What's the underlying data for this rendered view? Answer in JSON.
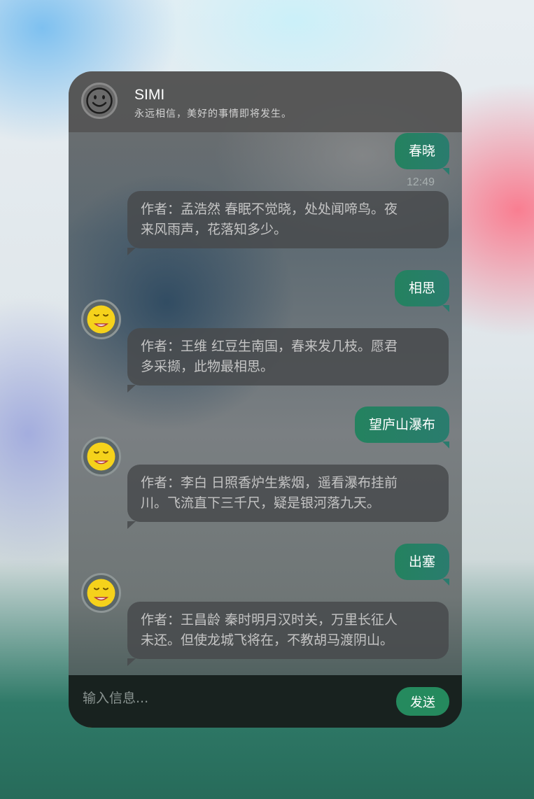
{
  "header": {
    "title": "SIMI",
    "subtitle": "永远相信，美好的事情即将发生。",
    "avatar_icon": "smiley-face-icon"
  },
  "messages": [
    {
      "from": "user",
      "text": "春晓"
    },
    {
      "from": "timestamp",
      "text": "12:49"
    },
    {
      "from": "bot",
      "lines": [
        "作者：孟浩然 春眠不觉晓，处处闻啼鸟。夜",
        "来风雨声，花落知多少。"
      ]
    },
    {
      "from": "user",
      "text": "相思"
    },
    {
      "from": "bot",
      "lines": [
        "作者：王维 红豆生南国，春来发几枝。愿君",
        "多采撷，此物最相思。"
      ]
    },
    {
      "from": "user",
      "text": "望庐山瀑布"
    },
    {
      "from": "bot",
      "lines": [
        "作者：李白 日照香炉生紫烟，遥看瀑布挂前",
        "川。飞流直下三千尺，疑是银河落九天。"
      ]
    },
    {
      "from": "user",
      "text": "出塞"
    },
    {
      "from": "bot",
      "lines": [
        "作者：王昌龄 秦时明月汉时关，万里长征人",
        "未还。但使龙城飞将在，不教胡马渡阴山。"
      ]
    }
  ],
  "composer": {
    "placeholder": "输入信息...",
    "send_label": "发送"
  },
  "colors": {
    "accent_green": "#258a5e",
    "header_bg": "#555555",
    "footer_bg": "#18221f",
    "bot_avatar_icon": "yellow-smiley-icon"
  }
}
